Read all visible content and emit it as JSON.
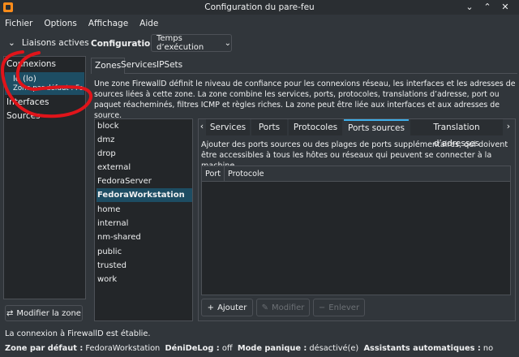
{
  "window": {
    "title": "Configuration du pare-feu",
    "controls": {
      "minimize": "⌄",
      "maximize": "⌃",
      "close": "✕"
    }
  },
  "menu": [
    "Fichier",
    "Options",
    "Affichage",
    "Aide"
  ],
  "left": {
    "header": "Liaisons actives",
    "categories": {
      "connections": "Connexions",
      "interfaces": "Interfaces",
      "sources": "Sources"
    },
    "connection_item": {
      "name": "lo (lo)",
      "zone": "Zone par défaut : FedoraWorkstation"
    },
    "modify_zone_button": "Modifier la zone",
    "annotation_color": "#e0141a"
  },
  "config": {
    "label": "Configuration :",
    "value": "Temps d’exécution"
  },
  "tabs": [
    "Zones",
    "Services",
    "IPSets"
  ],
  "zone_description": "Une zone FirewallD définit le niveau de confiance pour les connexions réseau, les interfaces et les adresses de sources liées à cette zone. La zone combine les services, ports, protocoles, translations d’adresse, port ou paquet réacheminés, filtres ICMP et règles riches. La zone peut être liée aux interfaces et aux adresses de source.",
  "zones": [
    "block",
    "dmz",
    "drop",
    "external",
    "FedoraServer",
    "FedoraWorkstation",
    "home",
    "internal",
    "nm-shared",
    "public",
    "trusted",
    "work"
  ],
  "selected_zone": "FedoraWorkstation",
  "subtabs": [
    "Services",
    "Ports",
    "Protocoles",
    "Ports sources",
    "Translation d’adresses"
  ],
  "active_subtab": "Ports sources",
  "source_ports": {
    "description": "Ajouter des ports sources ou des plages de ports supplémentaires, qui doivent être accessibles à tous les hôtes ou réseaux qui peuvent se connecter à la machine.",
    "columns": [
      "Port",
      "Protocole"
    ],
    "rows": []
  },
  "actions": {
    "add": "Ajouter",
    "edit": "Modifier",
    "remove": "Enlever"
  },
  "status": {
    "connection": "La connexion à FirewallD est établie.",
    "default_zone_label": "Zone par défaut :",
    "default_zone": "FedoraWorkstation",
    "denied_log_label": "DéniDeLog :",
    "denied_log": "off",
    "panic_label": "Mode panique :",
    "panic": "désactivé(e)",
    "helpers_label": "Assistants automatiques :",
    "helpers": "no"
  },
  "colors": {
    "background": "#31363b",
    "selection": "#1d4d63",
    "accent": "#3daee9",
    "field": "#232629"
  }
}
